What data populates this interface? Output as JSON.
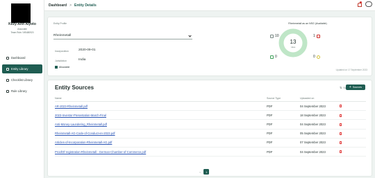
{
  "user": {
    "name": "Kezy-Ann Alyoto",
    "role": "Associate",
    "id": "Team Role / M5480920"
  },
  "sidebar": {
    "items": [
      {
        "label": "Dashboard"
      },
      {
        "label": "Entity Library"
      },
      {
        "label": "Checklist Library"
      },
      {
        "label": "Rule Library"
      }
    ]
  },
  "header": {
    "breadcrumb_root": "Dashboard",
    "breadcrumb_sep": ">",
    "breadcrumb_current": "Entity Details"
  },
  "profile": {
    "section_label": "Entity Profile",
    "entity": "Rheinmetall",
    "incorporation_label": "Incorporation",
    "incorporation_date": "2020-09-01",
    "jurisdiction_label": "Jurisdiction",
    "jurisdiction": "India",
    "checkbox_label": "Allowable"
  },
  "stats": {
    "title": "Rheinmetall as an NSG (Available)",
    "donut_value": "13",
    "donut_sub": "rules",
    "items": [
      {
        "icon": "document-icon",
        "value": "10",
        "color": "#7a8a86"
      },
      {
        "icon": "flag-icon",
        "value": "1",
        "color": "#d0312d"
      },
      {
        "icon": "check-icon",
        "value": "0",
        "color": "#3fa15b"
      },
      {
        "icon": "clock-icon",
        "value": "0",
        "color": "#d4c23a"
      }
    ],
    "donut_colors": {
      "main": "#bfe6c7",
      "accent": "#e0f2e4"
    },
    "updated": "Updated on 17 September 2023"
  },
  "sources": {
    "title": "Entity Sources",
    "sort_label": "Sort",
    "add_label": "Sources",
    "columns": [
      "Name",
      "Source Type",
      "Uploaded on"
    ],
    "rows": [
      {
        "name": "AR-2023-Rheinmetall.pdf",
        "type": "PDF",
        "date": "04 September 2023"
      },
      {
        "name": "2023-Investor-Presentation-March-Final",
        "type": "PDF",
        "date": "18 September 2023"
      },
      {
        "name": "Anti-Money-Laundering_Rheinmetall.pdf",
        "type": "PDF",
        "date": "04 September 2023"
      },
      {
        "name": "Rheinmetall-AG-Code-of-Conduct-en-2023.pdf",
        "type": "PDF",
        "date": "05 September 2023"
      },
      {
        "name": "Articles-of-Incorporation-Rheinmetall-AG.pdf",
        "type": "PDF",
        "date": "07 September 2023"
      },
      {
        "name": "ProofOf-registration-Rheinmetall - German-Chamber-of-Commerce.pdf",
        "type": "PDF",
        "date": "04 September 2023"
      }
    ],
    "page": "1",
    "prev": "<"
  }
}
